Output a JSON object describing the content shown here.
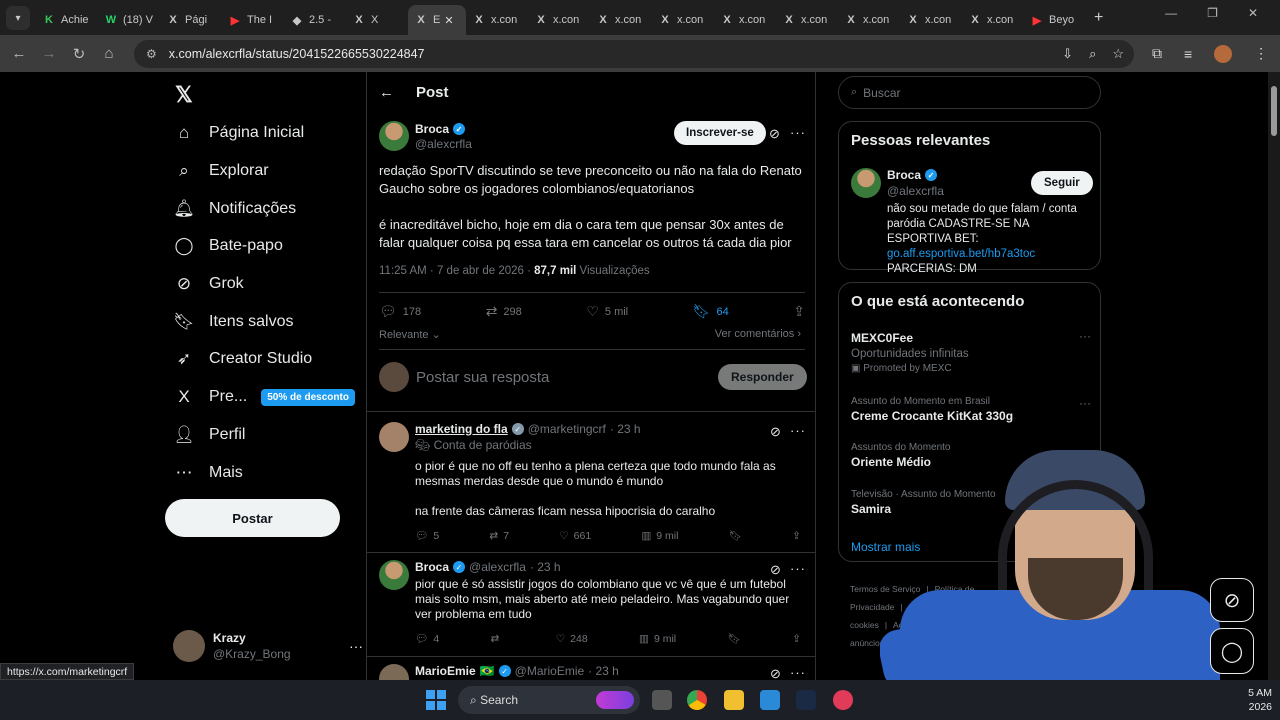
{
  "browser": {
    "tabs": [
      {
        "title": "Achie",
        "icon": "K"
      },
      {
        "title": "(18) V",
        "icon": "W"
      },
      {
        "title": "Pági",
        "icon": "X"
      },
      {
        "title": "The I",
        "icon": "▶"
      },
      {
        "title": "2.5 -",
        "icon": "◆"
      },
      {
        "title": "X",
        "icon": "X"
      },
      {
        "title": "E",
        "icon": "X"
      },
      {
        "title": "x.con",
        "icon": "X"
      },
      {
        "title": "x.con",
        "icon": "X"
      },
      {
        "title": "x.con",
        "icon": "X"
      },
      {
        "title": "x.con",
        "icon": "X"
      },
      {
        "title": "x.con",
        "icon": "X"
      },
      {
        "title": "x.con",
        "icon": "X"
      },
      {
        "title": "x.con",
        "icon": "X"
      },
      {
        "title": "x.con",
        "icon": "X"
      },
      {
        "title": "x.con",
        "icon": "X"
      },
      {
        "title": "Beyo",
        "icon": "▶"
      }
    ],
    "url": "x.com/alexcrfla/status/2041522665530224847",
    "status_url": "https://x.com/marketingcrf"
  },
  "nav": {
    "items": [
      {
        "label": "Página Inicial",
        "icon": "home-icon",
        "glyph": "⌂"
      },
      {
        "label": "Explorar",
        "icon": "search-icon",
        "glyph": "⌕"
      },
      {
        "label": "Notificações",
        "icon": "bell-icon",
        "glyph": "🔔︎"
      },
      {
        "label": "Bate-papo",
        "icon": "chat-icon",
        "glyph": "◯"
      },
      {
        "label": "Grok",
        "icon": "grok-icon",
        "glyph": "⊘"
      },
      {
        "label": "Itens salvos",
        "icon": "bookmark-icon",
        "glyph": "🔖︎"
      },
      {
        "label": "Creator Studio",
        "icon": "rocket-icon",
        "glyph": "➶"
      },
      {
        "label": "Pre...",
        "icon": "x-premium-icon",
        "glyph": "X"
      },
      {
        "label": "Perfil",
        "icon": "person-icon",
        "glyph": "👤︎"
      },
      {
        "label": "Mais",
        "icon": "more-circle-icon",
        "glyph": "⋯"
      }
    ],
    "promo": "50% de desconto",
    "post_button": "Postar",
    "account": {
      "name": "Krazy",
      "handle": "@Krazy_Bong"
    }
  },
  "post": {
    "header": "Post",
    "author": "Broca",
    "handle": "@alexcrfla",
    "subscribe": "Inscrever-se",
    "paragraphs": [
      "redação SporTV discutindo se teve preconceito ou não na fala do Renato Gaucho sobre os jogadores colombianos/equatorianos",
      "é inacreditável bicho, hoje em dia o cara tem que pensar 30x antes de falar qualquer coisa pq essa tara em cancelar os outros tá cada dia pior"
    ],
    "time": "11:25 AM · 7 de abr de 2026 · ",
    "views": "87,7 mil",
    "views_label": " Visualizações",
    "replies": "178",
    "reposts": "298",
    "likes": "5 mil",
    "bookmarks": "64",
    "sort": "Relevante",
    "view_comments": "Ver comentários",
    "reply_placeholder": "Postar sua resposta",
    "reply_button": "Responder"
  },
  "comments": [
    {
      "name": "marketing do fla",
      "handle": "@marketingcrf",
      "time": "· 23 h",
      "parody": "Conta de paródias",
      "text1": "o pior é que no off eu tenho a plena certeza que todo mundo fala as mesmas merdas desde que o mundo é mundo",
      "text2": "na frente das câmeras ficam nessa hipocrisia do caralho",
      "replies": "5",
      "reposts": "7",
      "likes": "661",
      "views": "9 mil"
    },
    {
      "name": "Broca",
      "handle": "@alexcrfla",
      "time": "· 23 h",
      "text1": "pior que é só assistir jogos do colombiano que vc vê que é um futebol mais solto msm, mais aberto até meio peladeiro. Mas vagabundo quer ver problema em tudo",
      "replies": "4",
      "reposts": "",
      "likes": "248",
      "views": "9 mil"
    },
    {
      "name": "MarioEmie",
      "flag": "🇧🇷",
      "handle": "@MarioEmie",
      "time": "· 23 h"
    }
  ],
  "sidebar": {
    "search_placeholder": "Buscar",
    "relevant_title": "Pessoas relevantes",
    "relevant": {
      "name": "Broca",
      "handle": "@alexcrfla",
      "follow": "Seguir",
      "bio1": "não sou metade do que falam / conta paródia CADASTRE-SE NA ESPORTIVA BET: ",
      "bio_link": "go.aff.esportiva.bet/hb7a3toc",
      "bio2": "PARCERIAS: DM"
    },
    "trending_title": "O que está acontecendo",
    "trends": [
      {
        "context": "",
        "name": "MEXC0Fee",
        "desc": "Oportunidades infinitas",
        "promo": "Promoted by MEXC"
      },
      {
        "context": "Assunto do Momento em Brasil",
        "name": "Creme Crocante KitKat 330g"
      },
      {
        "context": "Assuntos do Momento",
        "name": "Oriente Médio"
      },
      {
        "context": "Televisão · Assunto do Momento",
        "name": "Samira"
      }
    ],
    "show_more": "Mostrar mais",
    "footer": [
      "Termos de Serviço",
      "|",
      "Política de Privacidade",
      "|",
      "Política de cookies",
      "|",
      "Acessibilidade",
      "|",
      "Informações de anúncios",
      "|",
      "Mais ..."
    ]
  },
  "taskbar": {
    "search": "Search",
    "time": "5 AM",
    "date": "2026"
  }
}
